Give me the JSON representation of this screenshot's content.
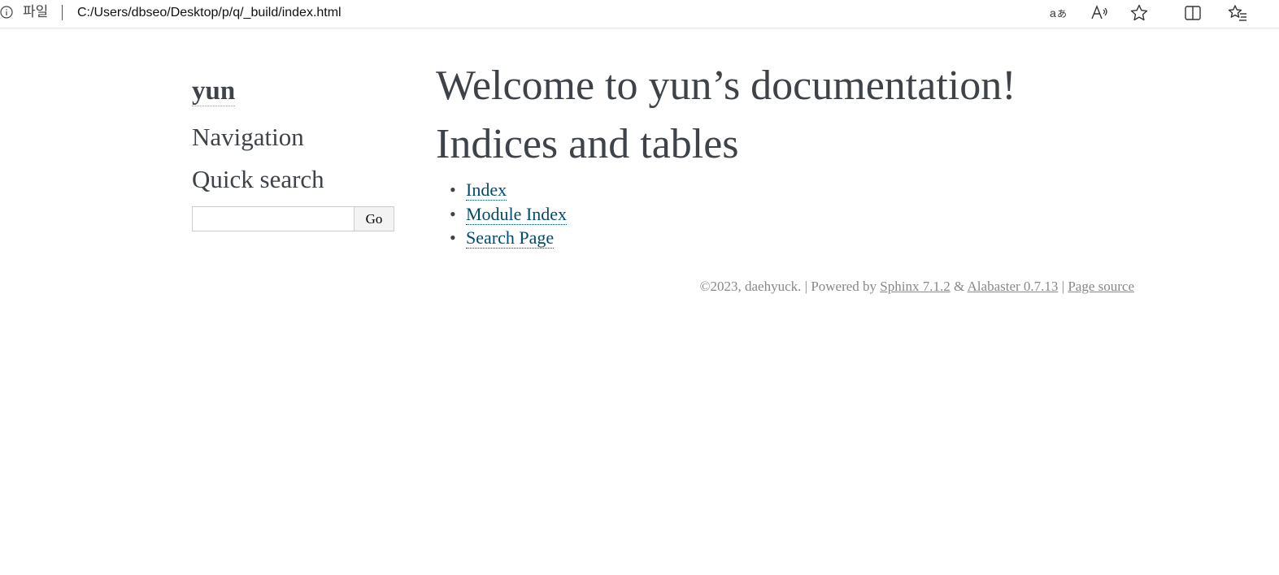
{
  "browser": {
    "scheme_label": "파일",
    "url": "C:/Users/dbseo/Desktop/p/q/_build/index.html",
    "icons": [
      "info-icon",
      "translate-icon",
      "read-aloud-icon",
      "favorite-star-icon",
      "split-screen-icon",
      "favorites-list-icon"
    ]
  },
  "sidebar": {
    "logo": "yun",
    "navigation_heading": "Navigation",
    "search_heading": "Quick search",
    "search_value": "",
    "search_button": "Go"
  },
  "main": {
    "title": "Welcome to yun’s documentation!",
    "section_title": "Indices and tables",
    "links": [
      {
        "label": "Index"
      },
      {
        "label": "Module Index"
      },
      {
        "label": "Search Page"
      }
    ]
  },
  "footer": {
    "copyright": "©2023, daehyuck.",
    "sep1": "|",
    "powered_by": "Powered by",
    "sphinx": "Sphinx 7.1.2",
    "amp": "&",
    "alabaster": "Alabaster 0.7.13",
    "sep2": "|",
    "page_source": "Page source"
  },
  "colors": {
    "text": "#3e4349",
    "link": "#004b6b",
    "footer": "#888888"
  }
}
